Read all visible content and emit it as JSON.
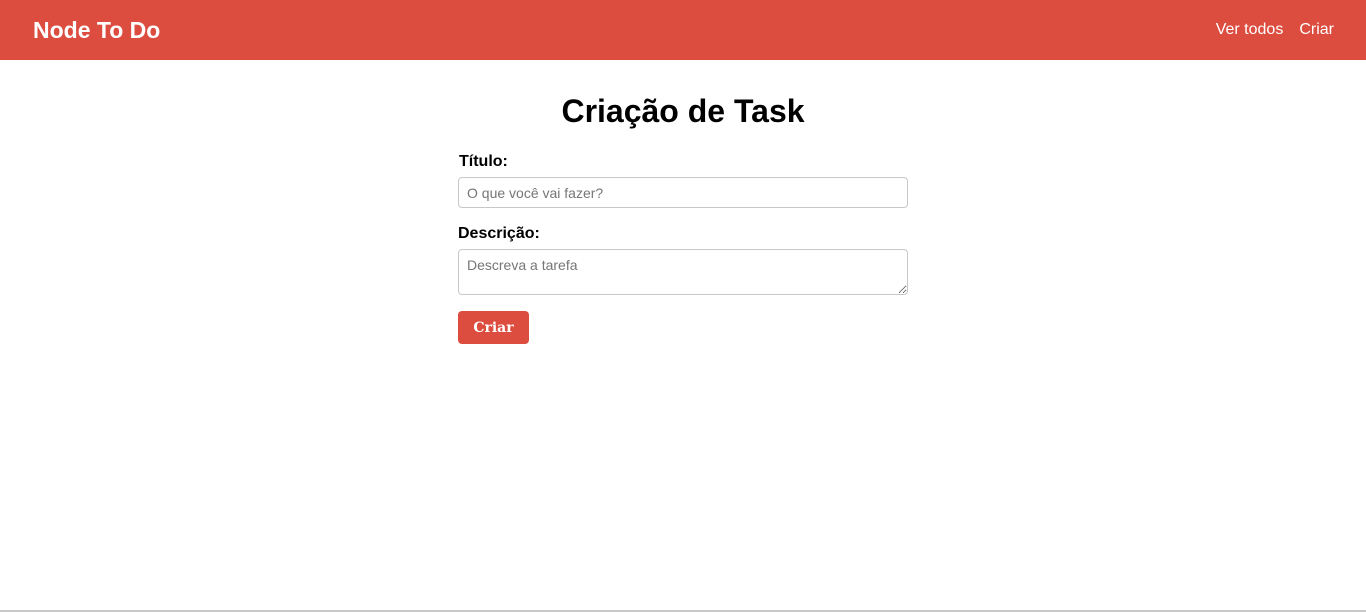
{
  "header": {
    "brand": "Node To Do",
    "nav": [
      {
        "label": "Ver todos"
      },
      {
        "label": "Criar"
      }
    ]
  },
  "main": {
    "title": "Criação de Task",
    "form": {
      "title_label": "Título:",
      "title_placeholder": "O que você vai fazer?",
      "title_value": "",
      "description_label": "Descrição:",
      "description_placeholder": "Descreva a tarefa",
      "description_value": "",
      "submit_label": "Criar"
    }
  },
  "colors": {
    "brand": "#dc4c3f",
    "text_on_brand": "#ffffff",
    "border": "#c7c7c7"
  }
}
